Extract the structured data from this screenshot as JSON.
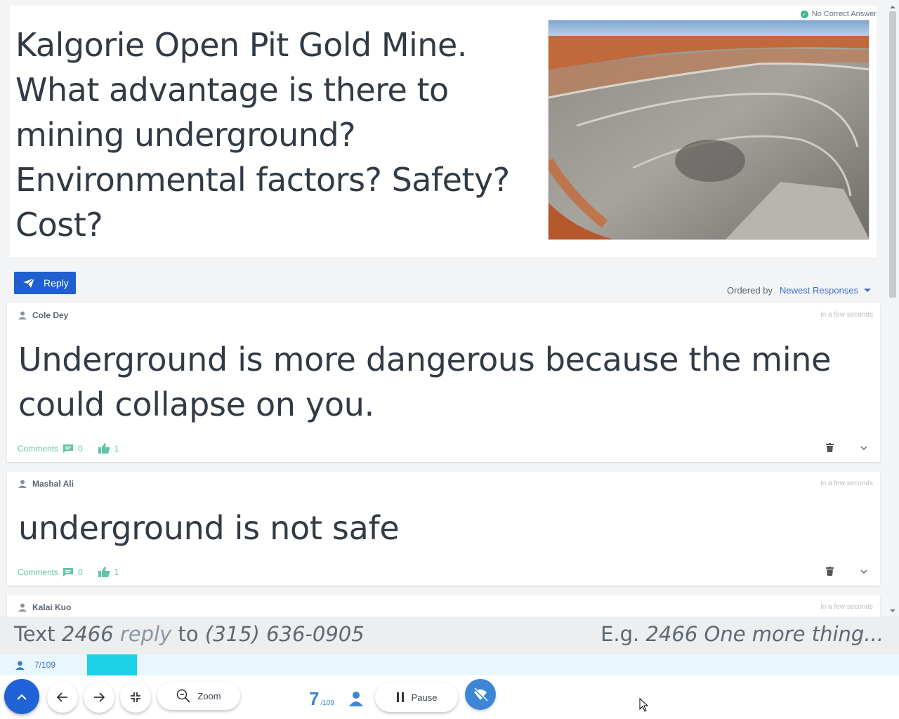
{
  "question": {
    "text": "Kalgorie Open Pit Gold Mine.  What advantage is there to mining underground?  Environmental factors? Safety? Cost?",
    "badge": "No Correct Answer"
  },
  "reply": {
    "label": "Reply"
  },
  "ordering": {
    "label": "Ordered by",
    "selected": "Newest Responses"
  },
  "responses": [
    {
      "author": "Cole Dey",
      "time": "in a few seconds",
      "text": "Underground is more dangerous because the mine could collapse on you.",
      "comments_label": "Comments",
      "comments_count": "0",
      "likes": "1"
    },
    {
      "author": "Mashal Ali",
      "time": "in a few seconds",
      "text": "underground is not safe",
      "comments_label": "Comments",
      "comments_count": "0",
      "likes": "1"
    },
    {
      "author": "Kalai Kuo",
      "time": "in a few seconds",
      "text": "",
      "comments_label": "",
      "comments_count": "",
      "likes": ""
    }
  ],
  "sms": {
    "text_word": "Text",
    "code": "2466",
    "reply_word": "reply",
    "to_word": "to",
    "phone": "(315) 636-0905",
    "eg_label": "E.g.",
    "example": "2466 One more thing..."
  },
  "progress": {
    "count": "7",
    "total": "/109",
    "label": "7/109",
    "fraction": 0.064
  },
  "toolbar": {
    "zoom_label": "Zoom",
    "pause_label": "Pause",
    "counter_current": "7",
    "counter_total": "/109"
  },
  "colors": {
    "accent": "#1f5fcf",
    "progress": "#1cd1e8",
    "badge": "#3fb68b",
    "likes": "#64c3a9"
  }
}
